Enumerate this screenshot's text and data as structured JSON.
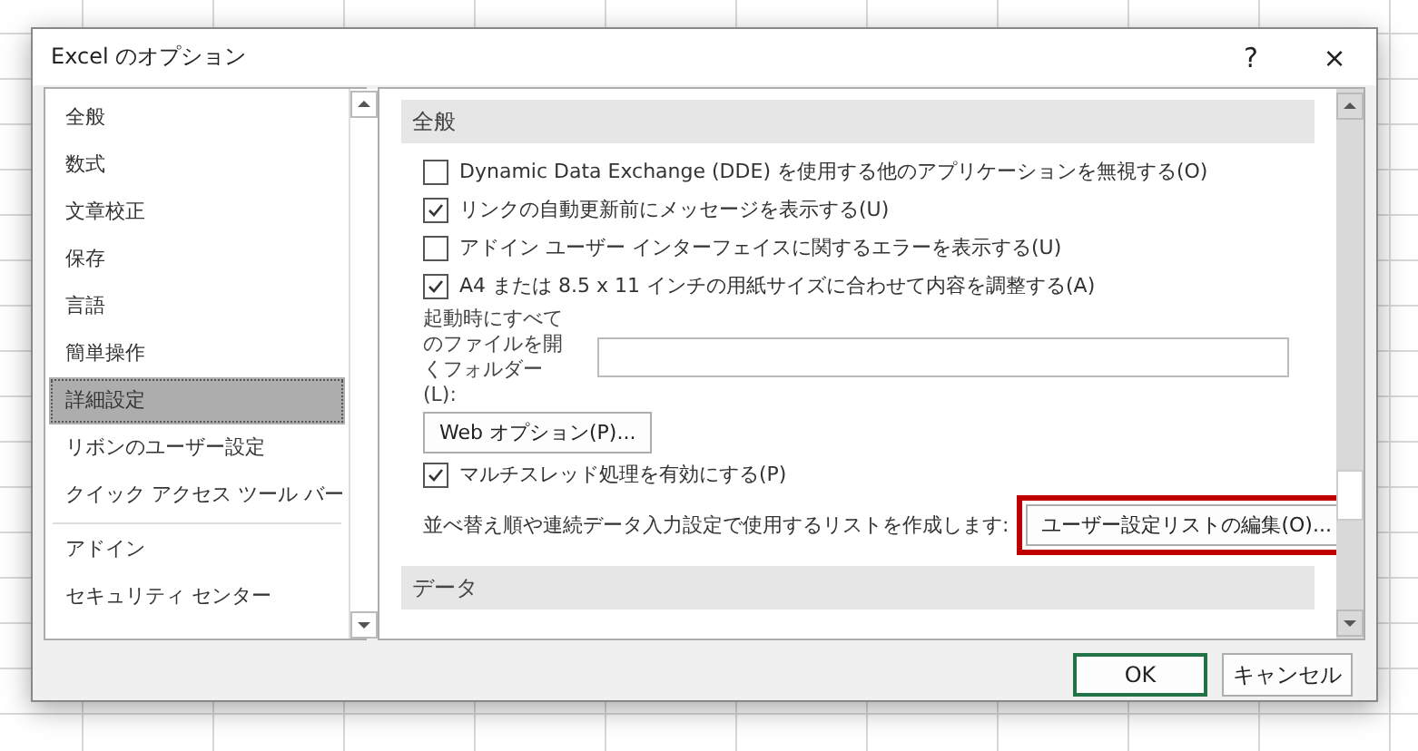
{
  "window": {
    "title": "Excel のオプション",
    "help": "?",
    "close": "×"
  },
  "sidebar": {
    "groups": [
      [
        {
          "label": "全般",
          "selected": false
        },
        {
          "label": "数式",
          "selected": false
        },
        {
          "label": "文章校正",
          "selected": false
        },
        {
          "label": "保存",
          "selected": false
        },
        {
          "label": "言語",
          "selected": false
        },
        {
          "label": "簡単操作",
          "selected": false
        },
        {
          "label": "詳細設定",
          "selected": true
        },
        {
          "label": "リボンのユーザー設定",
          "selected": false
        },
        {
          "label": "クイック アクセス ツール バー",
          "selected": false
        }
      ],
      [
        {
          "label": "アドイン",
          "selected": false
        },
        {
          "label": "セキュリティ センター",
          "selected": false
        }
      ]
    ]
  },
  "sections": [
    {
      "title": "全般",
      "items": [
        {
          "kind": "checkbox",
          "label": "Dynamic Data Exchange (DDE) を使用する他のアプリケーションを無視する(O)",
          "checked": false
        },
        {
          "kind": "checkbox",
          "label": "リンクの自動更新前にメッセージを表示する(U)",
          "checked": true
        },
        {
          "kind": "checkbox",
          "label": "アドイン ユーザー インターフェイスに関するエラーを表示する(U)",
          "checked": false
        },
        {
          "kind": "checkbox",
          "label": "A4 または 8.5 x 11 インチの用紙サイズに合わせて内容を調整する(A)",
          "checked": true
        },
        {
          "kind": "field",
          "label": "起動時にすべてのファイルを開くフォルダー(L):"
        },
        {
          "kind": "button",
          "label": "Web オプション(P)..."
        },
        {
          "kind": "checkbox",
          "label": "マルチスレッド処理を有効にする(P)",
          "checked": true
        },
        {
          "kind": "button-row",
          "label": "並べ替え順や連続データ入力設定で使用するリストを作成します:",
          "button": "ユーザー設定リストの編集(O)...",
          "highlighted": true
        }
      ]
    },
    {
      "title": "データ"
    }
  ],
  "buttons": [
    {
      "label": "OK",
      "default": true
    },
    {
      "label": "キャンセル",
      "default": false
    }
  ]
}
